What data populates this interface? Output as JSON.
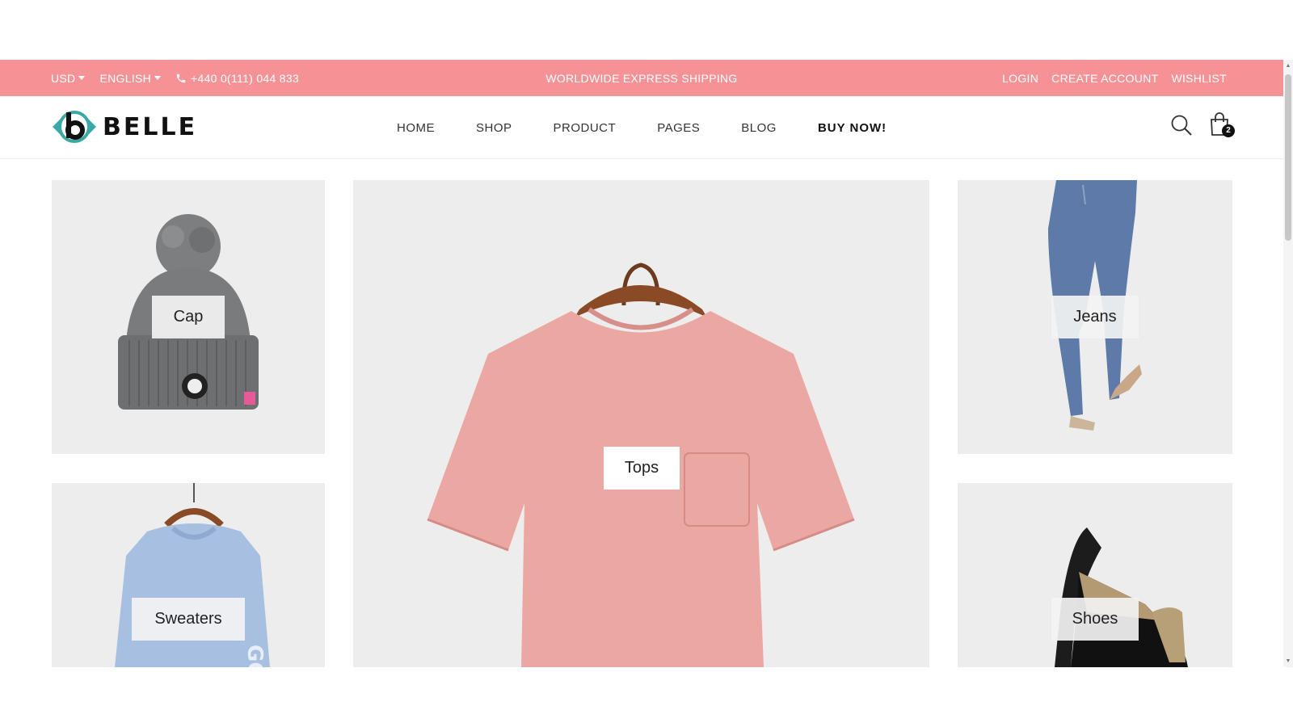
{
  "topbar": {
    "currency": "USD",
    "language": "ENGLISH",
    "phone": "+440 0(111) 044 833",
    "promo": "WORLDWIDE EXPRESS SHIPPING",
    "login": "LOGIN",
    "create_account": "CREATE ACCOUNT",
    "wishlist": "WISHLIST",
    "background_color": "#f49296"
  },
  "header": {
    "brand": "BELLE",
    "nav": [
      "HOME",
      "SHOP",
      "PRODUCT",
      "PAGES",
      "BLOG",
      "BUY NOW!"
    ],
    "cart_count": "2",
    "logo_accent_color": "#3aa8a4"
  },
  "categories": {
    "cap": "Cap",
    "tops": "Tops",
    "jeans": "Jeans",
    "sweaters": "Sweaters",
    "shoes": "Shoes"
  }
}
